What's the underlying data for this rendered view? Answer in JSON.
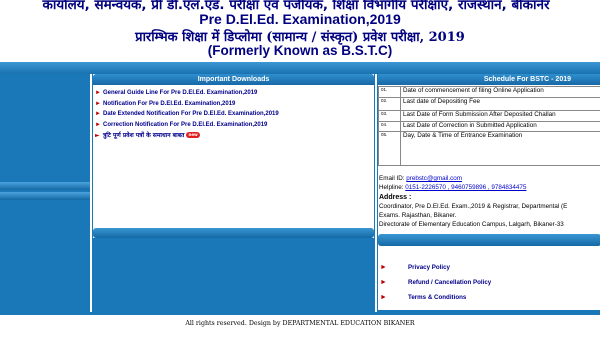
{
  "header": {
    "line1": "कार्यालय, समन्वयक, प्री डी.एल.एड. परीक्षा एवं पंजीयक, शिक्षा विभागीय परीक्षाएं, राजस्थान, बीकानेर",
    "line2": "Pre D.El.Ed. Examination,2019",
    "line3": "प्रारम्भिक शिक्षा में डिप्लोमा (सामान्य / संस्कृत) प्रवेश परीक्षा, 2019",
    "line4": "(Formerly Known as B.S.T.C)"
  },
  "downloads": {
    "title": "Important Downloads",
    "items": [
      "General Guide Line For Pre D.El.Ed. Examination,2019",
      "Notification For Pre D.El.Ed. Examination,2019",
      "Date Extended Notification For Pre D.El.Ed. Examination,2019",
      "Correction Notification For Pre D.El.Ed. Examination,2019",
      "त्रुटि पूर्ण प्रवेश पत्रों के समाधान बाबत"
    ],
    "new_badge": "new"
  },
  "schedule": {
    "title": "Schedule For BSTC - 2019",
    "rows": [
      {
        "num": "01.",
        "label": "Date of commencement of filing Online Application"
      },
      {
        "num": "02.",
        "label": "Last date of Depositing Fee"
      },
      {
        "num": "03.",
        "label": "Last Date of Form Submission After Deposited Challan"
      },
      {
        "num": "04.",
        "label": "Last Date of Correction in Submitted Application"
      },
      {
        "num": "05.",
        "label": "Day, Date & Time of Entrance Examination"
      }
    ]
  },
  "contact": {
    "email_label": "Email ID:",
    "email": "prebstc@gmail.com",
    "helpline_label": "Helpline:",
    "helpline": "0151-2226570 , 9460759896 , 9784834475",
    "address_heading": "Address :",
    "address_line1": "Coordinator, Pre D.El.Ed. Exam.,2019 & Registrar, Departmental (E",
    "address_line2": "Exams. Rajasthan, Bikaner.",
    "address_line3": "Directorate of Elementary Education Campus, Lalgarh, Bikaner-33"
  },
  "links": {
    "privacy": "Privacy Policy",
    "refund": "Refund / Cancellation Policy",
    "terms": "Terms & Conditions"
  },
  "footer": {
    "text": "All rights reserved. Design by DEPARTMENTAL EDUCATION BIKANER"
  },
  "colors": {
    "primary_blue": "#1b78b8",
    "header_text": "#000080",
    "bullet_red": "#c00000",
    "link_blue": "#00008b"
  }
}
